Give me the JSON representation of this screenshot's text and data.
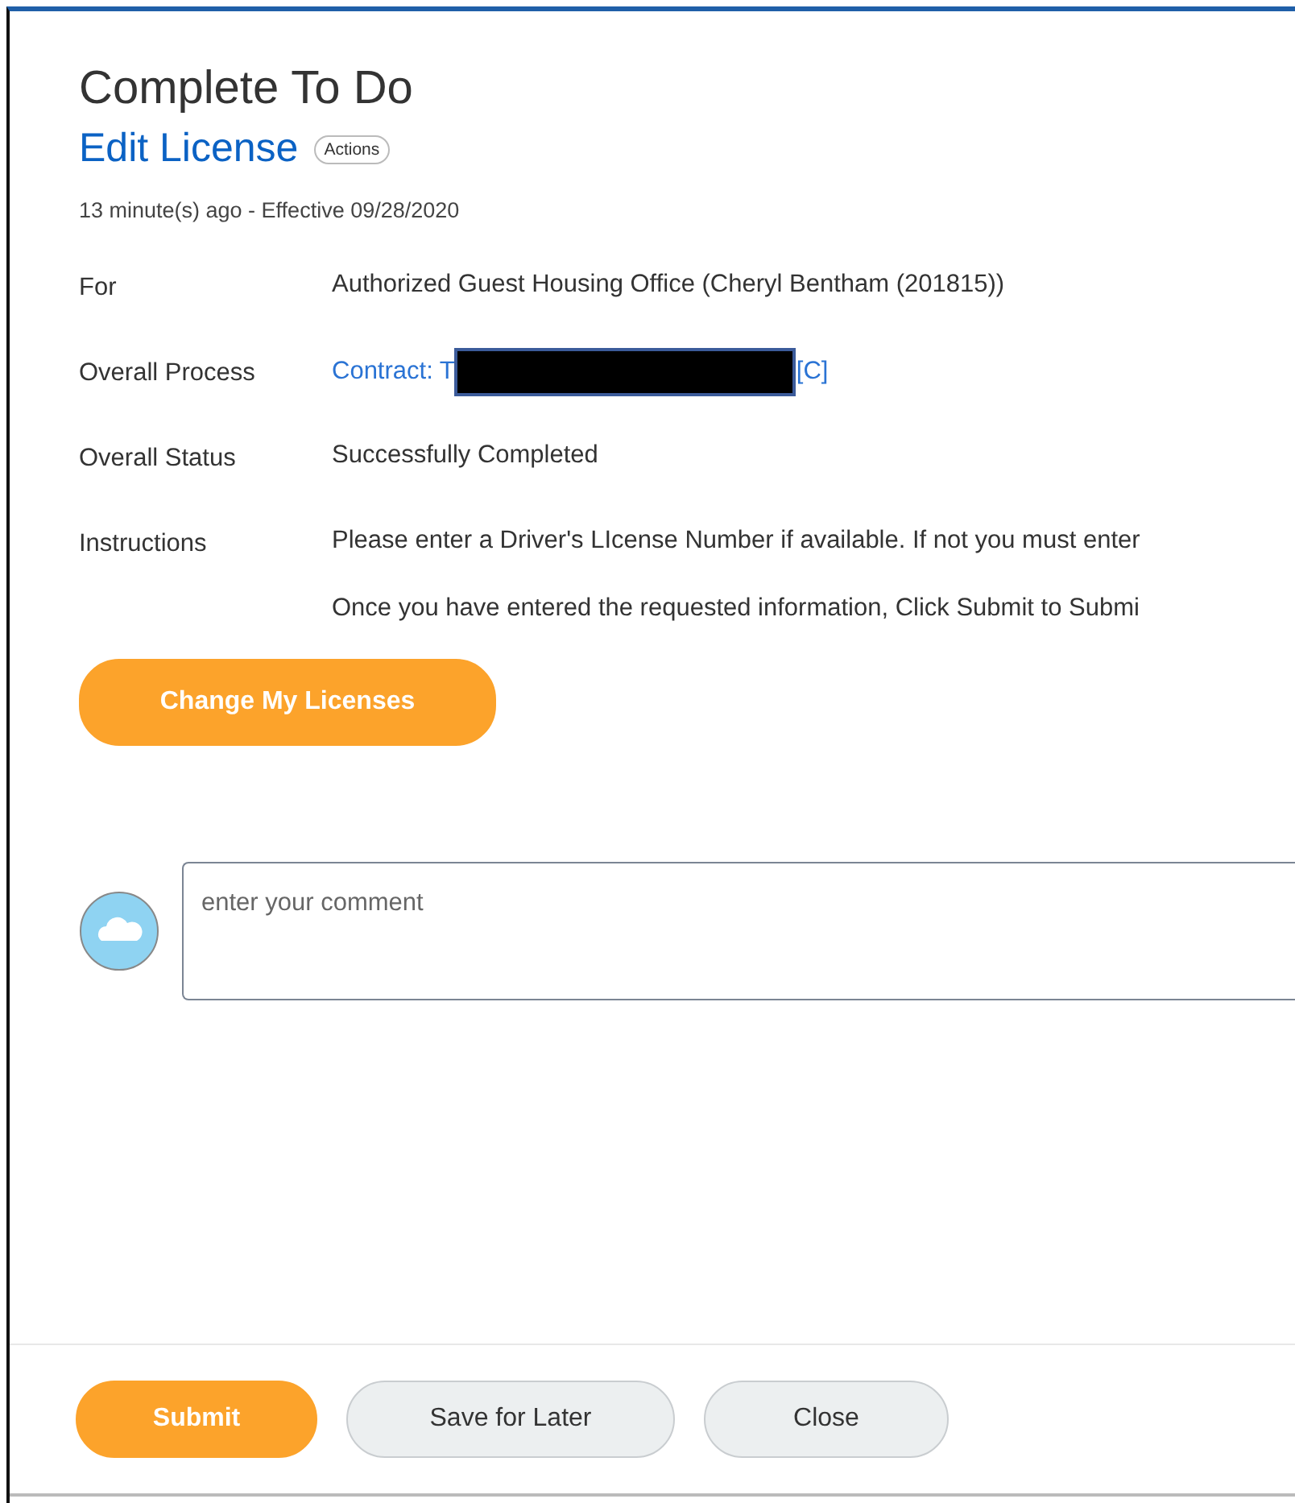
{
  "header": {
    "title": "Complete To Do",
    "subtitle": "Edit License",
    "actions_button": "Actions",
    "meta": "13 minute(s) ago -  Effective 09/28/2020"
  },
  "fields": [
    {
      "label": "For",
      "kind": "text",
      "value": "Authorized Guest Housing Office (Cheryl Bentham (201815))"
    },
    {
      "label": "Overall Process",
      "kind": "link",
      "value": "Contract: T",
      "redacted": true,
      "suffix": "[C]"
    },
    {
      "label": "Overall Status",
      "kind": "text",
      "value": "Successfully Completed"
    },
    {
      "label": "Instructions",
      "kind": "paragraphs",
      "paragraphs": [
        "Please enter a Driver's LIcense Number if available. If not you must enter",
        "Once you have entered the requested information, Click Submit to Submi"
      ]
    }
  ],
  "action_button": {
    "label": "Change My Licenses",
    "kind": "primary"
  },
  "comment": {
    "placeholder": "enter your comment"
  },
  "footer_buttons": [
    {
      "label": "Submit",
      "kind": "primary"
    },
    {
      "label": "Save for Later",
      "kind": "secondary"
    },
    {
      "label": "Close",
      "kind": "secondary"
    }
  ]
}
